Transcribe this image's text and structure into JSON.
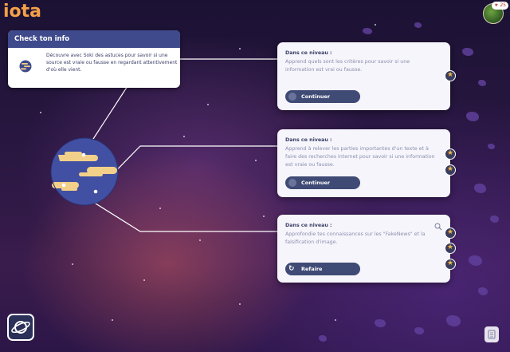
{
  "app": {
    "logo": "iota"
  },
  "user": {
    "badge": "25"
  },
  "info_card": {
    "title": "Check ton info",
    "text": "Découvre avec Soki des astuces pour savoir si une source est vraie ou fausse en regardant attentivement d'où elle vient."
  },
  "levels": [
    {
      "title": "Dans ce niveau :",
      "description": "Apprend quels sont les critères pour savoir si une information est vrai ou fausse.",
      "button": "Continuer",
      "stars": 1
    },
    {
      "title": "Dans ce niveau :",
      "description": "Apprend à relever les parties importantes d'un texte et à faire des recherches internet pour savoir si une information est vraie ou fausse.",
      "button": "Continuer",
      "stars": 2
    },
    {
      "title": "Dans ce niveau :",
      "description": "Approfondie tes connaissances sur les \"FakeNews\" et la falsification d'image.",
      "button": "Refaire",
      "stars": 3
    }
  ],
  "icons": {
    "planet": "planet-icon",
    "zoom": "zoom-icon",
    "star": "star-icon",
    "refresh": "refresh-icon",
    "notes": "notes-icon",
    "saturn": "saturn-icon"
  },
  "colors": {
    "accent": "#f5a04a",
    "header": "#3f4a8c",
    "button": "#3f4a75",
    "star": "#f0b64a"
  }
}
